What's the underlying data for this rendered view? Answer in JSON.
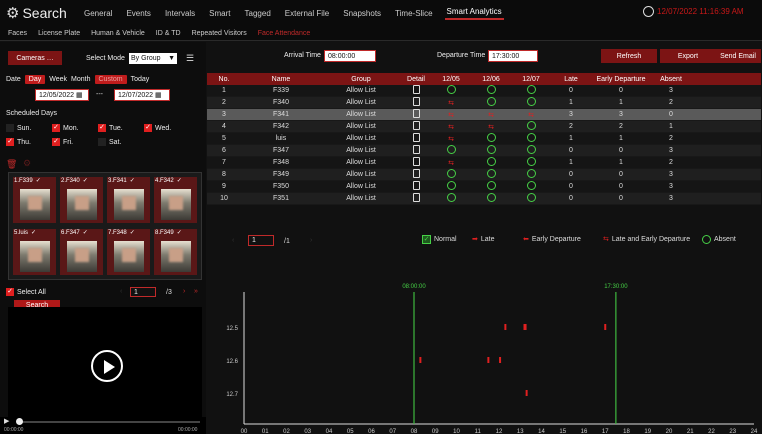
{
  "app": {
    "title": "Search"
  },
  "nav": [
    "General",
    "Events",
    "Intervals",
    "Smart",
    "Tagged",
    "External File",
    "Snapshots",
    "Time-Slice",
    "Smart Analytics"
  ],
  "nav_active": "Smart Analytics",
  "clock": "12/07/2022 11:16:39 AM",
  "subtabs": [
    "Faces",
    "License Plate",
    "Human & Vehicle",
    "ID & TD",
    "Repeated Visitors",
    "Face Attendance"
  ],
  "subtab_active": "Face Attendance",
  "filters": {
    "cameras_label": "Cameras",
    "select_mode_label": "Select Mode",
    "select_mode_value": "By Group",
    "date_label": "Date",
    "date_tabs": [
      "Day",
      "Week",
      "Month",
      "Custom",
      "Today"
    ],
    "start_date": "12/05/2022",
    "date_sep": "---",
    "end_date": "12/07/2022",
    "scheduled_days_label": "Scheduled Days"
  },
  "days": [
    {
      "label": "Sun.",
      "checked": false
    },
    {
      "label": "Mon.",
      "checked": true
    },
    {
      "label": "Tue.",
      "checked": true
    },
    {
      "label": "Wed.",
      "checked": true
    },
    {
      "label": "Thu.",
      "checked": true
    },
    {
      "label": "Fri.",
      "checked": true
    },
    {
      "label": "Sat.",
      "checked": false
    }
  ],
  "thumbs": [
    "1.F339",
    "2.F340",
    "3.F341",
    "4.F342",
    "5.luis",
    "6.F347",
    "7.F348",
    "8.F349"
  ],
  "select_all_label": "Select All",
  "pager_left": {
    "page": "1",
    "total": "/3"
  },
  "search_label": "Search",
  "video": {
    "time_start": "00:00:00",
    "time_end": "00:00:00"
  },
  "arrival": {
    "label": "Arrival Time",
    "value": "08:00:00"
  },
  "departure": {
    "label": "Departure Time",
    "value": "17:30:00"
  },
  "actions": {
    "refresh": "Refresh",
    "export": "Export",
    "send_email": "Send Email"
  },
  "table": {
    "headers": [
      "No.",
      "Name",
      "Group",
      "Detail",
      "12/05",
      "12/06",
      "12/07",
      "Late",
      "Early Departure",
      "Absent"
    ],
    "rows": [
      {
        "no": "1",
        "name": "F339",
        "group": "Allow List",
        "d": [
          "ok",
          "ok",
          "ok"
        ],
        "late": "0",
        "early": "0",
        "absent": "3"
      },
      {
        "no": "2",
        "name": "F340",
        "group": "Allow List",
        "d": [
          "late",
          "ok",
          "ok"
        ],
        "late": "1",
        "early": "1",
        "absent": "2"
      },
      {
        "no": "3",
        "name": "F341",
        "group": "Allow List",
        "d": [
          "late",
          "late",
          "late"
        ],
        "late": "3",
        "early": "3",
        "absent": "0"
      },
      {
        "no": "4",
        "name": "F342",
        "group": "Allow List",
        "d": [
          "late",
          "late",
          "ok"
        ],
        "late": "2",
        "early": "2",
        "absent": "1"
      },
      {
        "no": "5",
        "name": "luis",
        "group": "Allow List",
        "d": [
          "late",
          "ok",
          "ok"
        ],
        "late": "1",
        "early": "1",
        "absent": "2"
      },
      {
        "no": "6",
        "name": "F347",
        "group": "Allow List",
        "d": [
          "ok",
          "ok",
          "ok"
        ],
        "late": "0",
        "early": "0",
        "absent": "3"
      },
      {
        "no": "7",
        "name": "F348",
        "group": "Allow List",
        "d": [
          "late",
          "ok",
          "ok"
        ],
        "late": "1",
        "early": "1",
        "absent": "2"
      },
      {
        "no": "8",
        "name": "F349",
        "group": "Allow List",
        "d": [
          "ok",
          "ok",
          "ok"
        ],
        "late": "0",
        "early": "0",
        "absent": "3"
      },
      {
        "no": "9",
        "name": "F350",
        "group": "Allow List",
        "d": [
          "ok",
          "ok",
          "ok"
        ],
        "late": "0",
        "early": "0",
        "absent": "3"
      },
      {
        "no": "10",
        "name": "F351",
        "group": "Allow List",
        "d": [
          "ok",
          "ok",
          "ok"
        ],
        "late": "0",
        "early": "0",
        "absent": "3"
      }
    ]
  },
  "selected_row": "3",
  "pager_right": {
    "page": "1",
    "total": "/1"
  },
  "legend": {
    "normal": "Normal",
    "late": "Late",
    "early": "Early Departure",
    "late_early": "Late and Early Departure",
    "absent": "Absent"
  },
  "colors": {
    "accent": "#c01c1c",
    "ok": "#46d046",
    "late": "#e02020"
  },
  "chart_data": {
    "type": "scatter",
    "x_ticks": [
      "00",
      "01",
      "02",
      "03",
      "04",
      "05",
      "06",
      "07",
      "08",
      "09",
      "10",
      "11",
      "12",
      "13",
      "14",
      "15",
      "16",
      "17",
      "18",
      "19",
      "20",
      "21",
      "22",
      "23",
      "24"
    ],
    "y_ticks": [
      "12.5",
      "12.6",
      "12.7"
    ],
    "markers": [
      {
        "label": "08:00:00",
        "x": 8
      },
      {
        "label": "17:30:00",
        "x": 17.5
      }
    ],
    "points": [
      {
        "y": "12.5",
        "x": 12.3
      },
      {
        "y": "12.5",
        "x": 13.2
      },
      {
        "y": "12.5",
        "x": 13.25
      },
      {
        "y": "12.5",
        "x": 17.0
      },
      {
        "y": "12.6",
        "x": 8.3
      },
      {
        "y": "12.6",
        "x": 11.5
      },
      {
        "y": "12.6",
        "x": 12.05
      },
      {
        "y": "12.7",
        "x": 13.3
      }
    ]
  }
}
